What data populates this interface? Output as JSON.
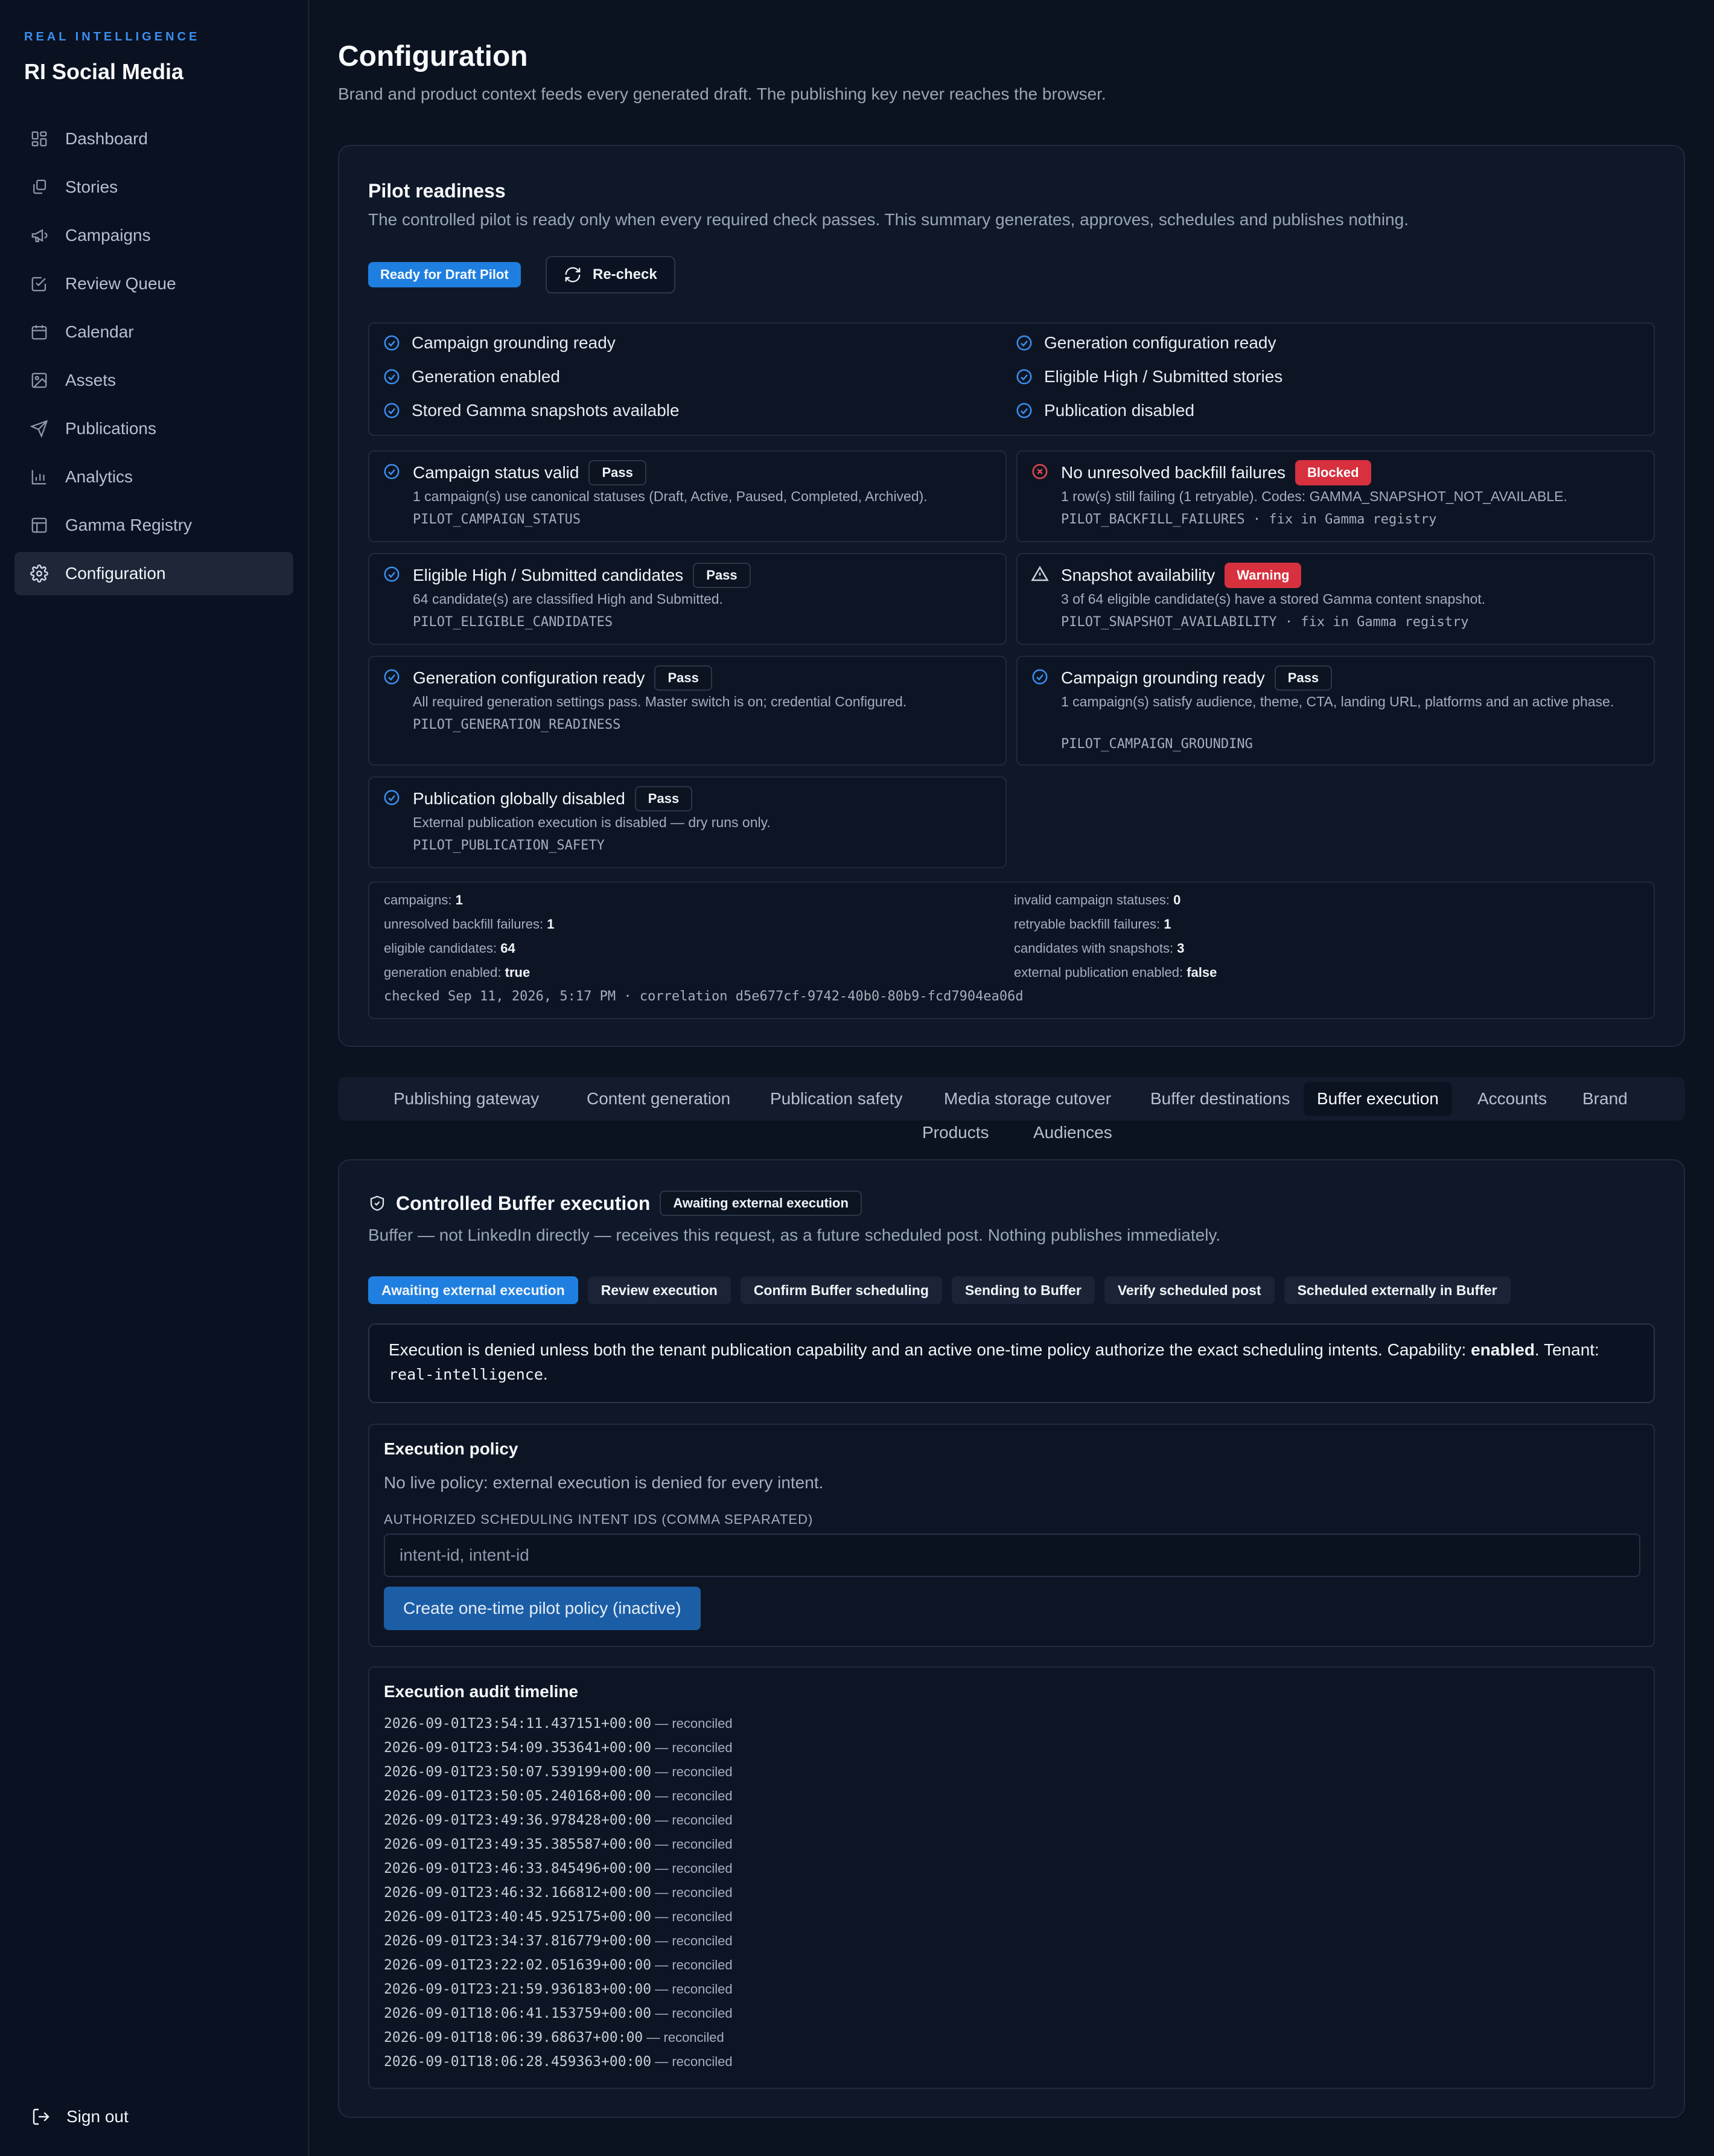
{
  "sidebar": {
    "kicker": "REAL INTELLIGENCE",
    "title": "RI Social Media",
    "items": [
      {
        "label": "Dashboard",
        "icon": "dashboard-icon"
      },
      {
        "label": "Stories",
        "icon": "stories-icon"
      },
      {
        "label": "Campaigns",
        "icon": "megaphone-icon"
      },
      {
        "label": "Review Queue",
        "icon": "check-square-icon"
      },
      {
        "label": "Calendar",
        "icon": "calendar-icon"
      },
      {
        "label": "Assets",
        "icon": "image-icon"
      },
      {
        "label": "Publications",
        "icon": "send-icon"
      },
      {
        "label": "Analytics",
        "icon": "bar-chart-icon"
      },
      {
        "label": "Gamma Registry",
        "icon": "table-icon"
      },
      {
        "label": "Configuration",
        "icon": "gear-icon",
        "active": true
      }
    ],
    "signout": "Sign out"
  },
  "page": {
    "title": "Configuration",
    "subtitle": "Brand and product context feeds every generated draft. The publishing key never reaches the browser."
  },
  "readiness": {
    "title": "Pilot readiness",
    "subtitle": "The controlled pilot is ready only when every required check passes. This summary generates, approves, schedules and publishes nothing.",
    "status_badge": "Ready for Draft Pilot",
    "recheck_label": "Re-check",
    "summary_checks": [
      "Campaign grounding ready",
      "Generation configuration ready",
      "Generation enabled",
      "Eligible High / Submitted stories",
      "Stored Gamma snapshots available",
      "Publication disabled"
    ],
    "tiles": [
      {
        "title": "Campaign status valid",
        "badge": "Pass",
        "body": "1 campaign(s) use canonical statuses (Draft, Active, Paused, Completed, Archived).",
        "code": "PILOT_CAMPAIGN_STATUS"
      },
      {
        "title": "No unresolved backfill failures",
        "badge": "Blocked",
        "body": "1 row(s) still failing (1 retryable). Codes: GAMMA_SNAPSHOT_NOT_AVAILABLE.",
        "code": "PILOT_BACKFILL_FAILURES · fix in Gamma registry"
      },
      {
        "title": "Eligible High / Submitted candidates",
        "badge": "Pass",
        "body": "64 candidate(s) are classified High and Submitted.",
        "code": "PILOT_ELIGIBLE_CANDIDATES"
      },
      {
        "title": "Snapshot availability",
        "badge": "Warning",
        "body": "3 of 64 eligible candidate(s) have a stored Gamma content snapshot.",
        "code": "PILOT_SNAPSHOT_AVAILABILITY · fix in Gamma registry"
      },
      {
        "title": "Generation configuration ready",
        "badge": "Pass",
        "body": "All required generation settings pass. Master switch is on; credential Configured.",
        "code": "PILOT_GENERATION_READINESS"
      },
      {
        "title": "Campaign grounding ready",
        "badge": "Pass",
        "body": "1 campaign(s) satisfy audience, theme, CTA, landing URL, platforms and an active phase.",
        "code": "PILOT_CAMPAIGN_GROUNDING"
      },
      {
        "title": "Publication globally disabled",
        "badge": "Pass",
        "body": "External publication execution is disabled — dry runs only.",
        "code": "PILOT_PUBLICATION_SAFETY"
      }
    ],
    "stats": [
      {
        "label": "campaigns:",
        "value": "1"
      },
      {
        "label": "invalid campaign statuses:",
        "value": "0"
      },
      {
        "label": "unresolved backfill failures:",
        "value": "1"
      },
      {
        "label": "retryable backfill failures:",
        "value": "1"
      },
      {
        "label": "eligible candidates:",
        "value": "64"
      },
      {
        "label": "candidates with snapshots:",
        "value": "3"
      },
      {
        "label": "generation enabled:",
        "value": "true"
      },
      {
        "label": "external publication enabled:",
        "value": "false"
      }
    ],
    "checked_line": "checked Sep 11, 2026, 5:17 PM · correlation d5e677cf-9742-40b0-80b9-fcd7904ea06d"
  },
  "tabs": [
    "Publishing gateway",
    "Content generation",
    "Publication safety",
    "Media storage cutover",
    "Buffer destinations",
    "Buffer execution",
    "Accounts",
    "Brand",
    "Products",
    "Audiences"
  ],
  "active_tab": "Buffer execution",
  "buffer": {
    "title": "Controlled Buffer execution",
    "status_badge": "Awaiting external execution",
    "subtitle": "Buffer — not LinkedIn directly — receives this request, as a future scheduled post. Nothing publishes immediately.",
    "steps": [
      "Awaiting external execution",
      "Review execution",
      "Confirm Buffer scheduling",
      "Sending to Buffer",
      "Verify scheduled post",
      "Scheduled externally in Buffer"
    ],
    "notice": {
      "text": "Execution is denied unless both the tenant publication capability and an active one-time policy authorize the exact scheduling intents. Capability: ",
      "capability": "enabled",
      "tenant_prefix": "Tenant: ",
      "tenant": "real-intelligence"
    },
    "policy": {
      "title": "Execution policy",
      "status": "No live policy: external execution is denied for every intent.",
      "field_label": "AUTHORIZED SCHEDULING INTENT IDS (COMMA SEPARATED)",
      "placeholder": "intent-id, intent-id",
      "button": "Create one-time pilot policy (inactive)"
    },
    "audit": {
      "title": "Execution audit timeline",
      "suffix": "— reconciled",
      "entries": [
        "2026-09-01T23:54:11.437151+00:00",
        "2026-09-01T23:54:09.353641+00:00",
        "2026-09-01T23:50:07.539199+00:00",
        "2026-09-01T23:50:05.240168+00:00",
        "2026-09-01T23:49:36.978428+00:00",
        "2026-09-01T23:49:35.385587+00:00",
        "2026-09-01T23:46:33.845496+00:00",
        "2026-09-01T23:46:32.166812+00:00",
        "2026-09-01T23:40:45.925175+00:00",
        "2026-09-01T23:34:37.816779+00:00",
        "2026-09-01T23:22:02.051639+00:00",
        "2026-09-01T23:21:59.936183+00:00",
        "2026-09-01T18:06:41.153759+00:00",
        "2026-09-01T18:06:39.68637+00:00",
        "2026-09-01T18:06:28.459363+00:00"
      ]
    }
  },
  "colors": {
    "accent": "#1f7fe0",
    "danger": "#d7303e",
    "background": "#0b1220"
  }
}
